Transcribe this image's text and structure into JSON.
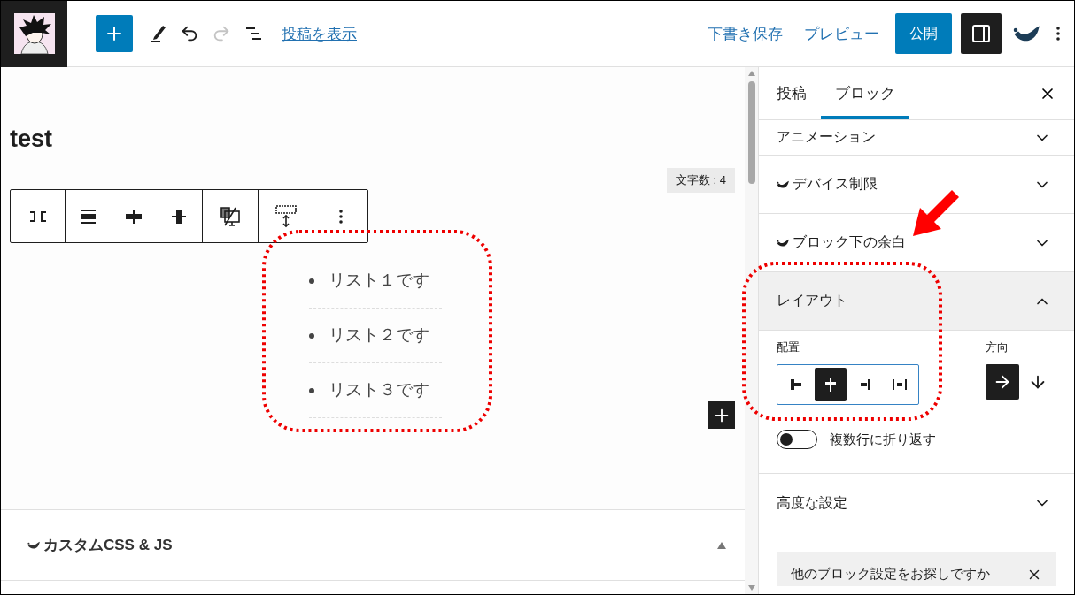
{
  "header": {
    "view_post_link": "投稿を表示",
    "save_draft": "下書き保存",
    "preview": "プレビュー",
    "publish": "公開",
    "settings_toggle": {
      "selected": true
    }
  },
  "editor": {
    "title": "test",
    "word_count": "文字数 : 4",
    "block_toolbar": {
      "justify_options": [
        {
          "selected": false
        },
        {
          "selected": false
        },
        {
          "selected": false
        }
      ]
    },
    "list_items": [
      "リスト１です",
      "リスト２です",
      "リスト３です"
    ]
  },
  "meta_box": {
    "title": "カスタムCSS & JS",
    "expanded": true
  },
  "sidebar": {
    "tabs": [
      {
        "label": "投稿",
        "selected": false
      },
      {
        "label": "ブロック",
        "selected": true
      }
    ],
    "panels": [
      {
        "title": "アニメーション",
        "plugin": false,
        "expanded": false
      },
      {
        "title": "デバイス制限",
        "plugin": true,
        "expanded": false
      },
      {
        "title": "ブロック下の余白",
        "plugin": true,
        "expanded": false
      },
      {
        "title": "レイアウト",
        "plugin": false,
        "expanded": true
      }
    ],
    "layout": {
      "justify_label": "配置",
      "justify_options": [
        {
          "kind": "left",
          "selected": false
        },
        {
          "kind": "center",
          "selected": true
        },
        {
          "kind": "right",
          "selected": false
        },
        {
          "kind": "between",
          "selected": false
        }
      ],
      "direction_label": "方向",
      "direction_options": [
        {
          "kind": "row",
          "selected": true
        },
        {
          "kind": "column",
          "selected": false
        }
      ],
      "wrap": {
        "label": "複数行に折り返す",
        "on": false
      }
    },
    "advanced": {
      "title": "高度な設定",
      "expanded": false
    },
    "notice": {
      "text": "他のブロック設定をお探しですか"
    }
  }
}
